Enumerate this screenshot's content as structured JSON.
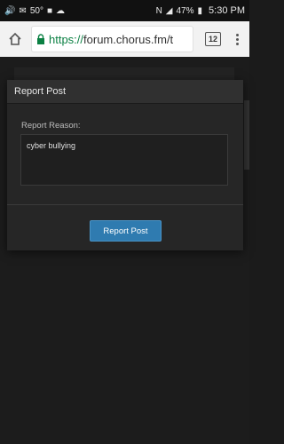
{
  "status_bar": {
    "signal_code": "50°",
    "battery_percent": "47%",
    "time": "5:30 PM",
    "icons": [
      "volume-icon",
      "message-icon",
      "weather-icon",
      "app-icon",
      "wifi-icon",
      "nfc-icon",
      "signal-icon",
      "battery-icon"
    ]
  },
  "browser": {
    "url_scheme": "https://",
    "url_host": "forum.chorus.fm/t",
    "tab_count": "12"
  },
  "modal": {
    "title": "Report Post",
    "reason_label": "Report Reason:",
    "reason_value": "cyber bullying",
    "submit_label": "Report Post"
  },
  "colors": {
    "accent_button": "#2f7bb0",
    "url_scheme": "#0b8043"
  }
}
